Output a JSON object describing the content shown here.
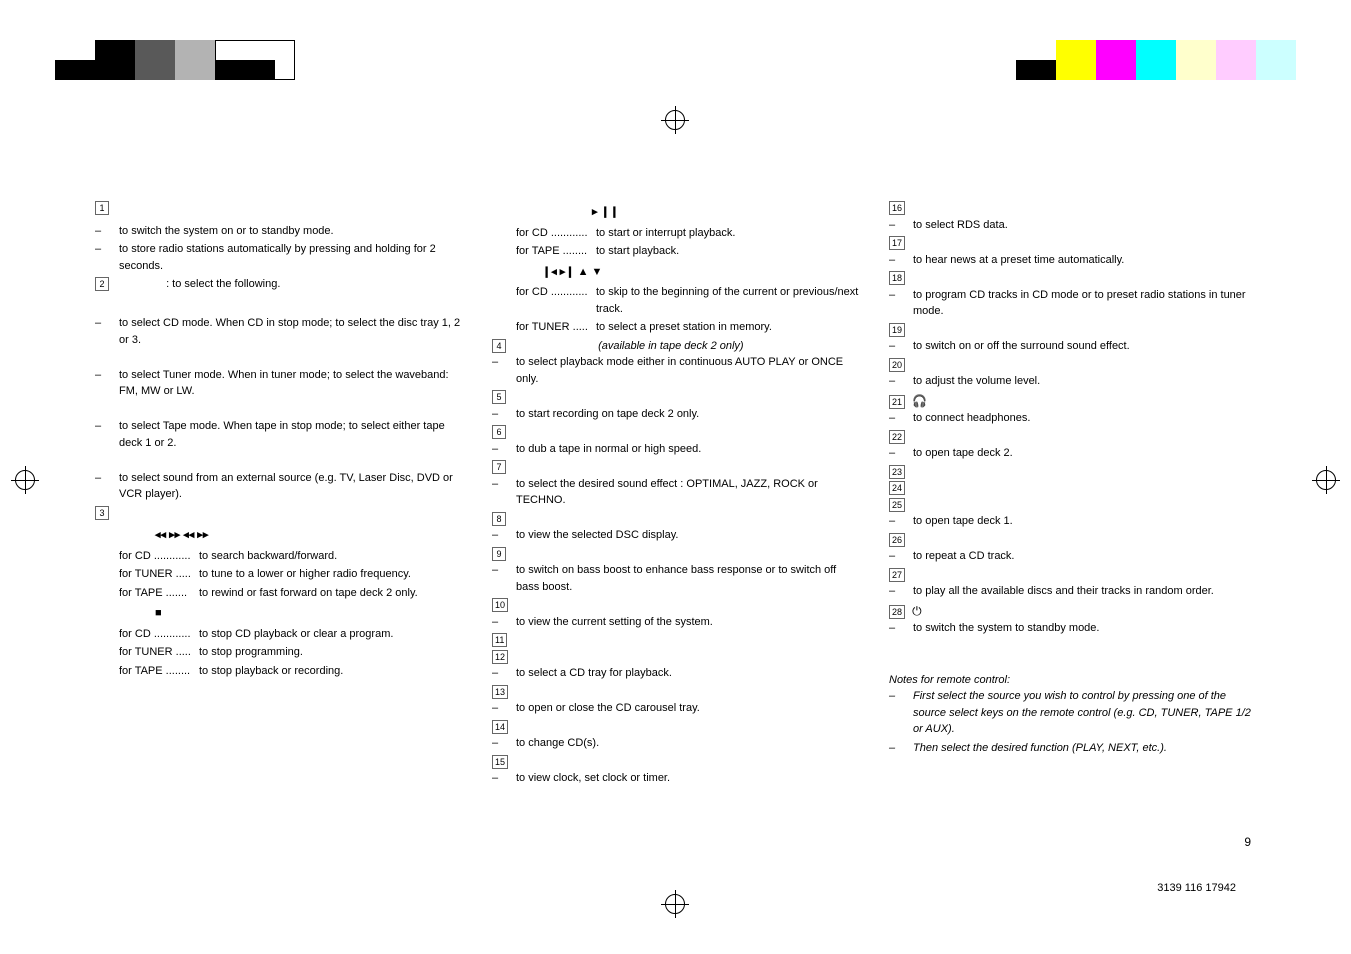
{
  "col1": {
    "n1_items": [
      "to switch the system on or to standby mode.",
      "to store radio stations automatically by pressing and holding for 2 seconds."
    ],
    "n2_intro": ": to select the following.",
    "n2_items": [
      "to select CD mode. When CD in stop mode; to select the disc tray 1, 2 or 3.",
      "to select Tuner mode. When in tuner mode; to select the waveband: FM, MW or LW.",
      "to select Tape mode. When tape in stop mode; to select either tape deck 1 or 2.",
      "to select sound from an external source (e.g. TV, Laser Disc, DVD or VCR player)."
    ],
    "n3_symbols": "◂◂ ▸▸          ◂◂ ▸▸",
    "n3_cd": "to search backward/forward.",
    "n3_tuner": "to tune to a lower or higher radio frequency.",
    "n3_tape": "to rewind or fast forward on tape deck 2 only.",
    "n3_stop": "■",
    "n3_cd_stop": "to stop CD playback or clear a program.",
    "n3_tuner_stop": "to stop programming.",
    "n3_tape_stop": "to stop playback or recording.",
    "labels": {
      "for_cd": "for CD ............",
      "for_tuner": "for TUNER .....",
      "for_tape": " for TAPE .......",
      "for_tape2": "for TAPE ........"
    }
  },
  "col2": {
    "sym_play": "▸ ❙❙",
    "cd_play": "to start or interrupt playback.",
    "tape_play": "to start playback.",
    "sym_skip": "❙◂          ▸❙          ▲ ▼",
    "cd_skip": "to skip to the beginning of the current or previous/next track.",
    "tuner_skip": "to select a preset station in memory.",
    "n4_note": "(available in tape deck 2 only)",
    "n4_item": "to select playback mode either in continuous AUTO PLAY or ONCE only.",
    "n5": "to start recording on tape deck 2 only.",
    "n6": "to dub a tape in normal or high speed.",
    "n7": "to select the desired sound effect : OPTIMAL, JAZZ, ROCK or TECHNO.",
    "n8": "to view the selected DSC display.",
    "n9": "to switch on bass boost to enhance bass response or to switch off bass boost.",
    "n10": "to view the current setting of the system.",
    "n12": "to select a CD tray for playback.",
    "n13": "to open or close the CD carousel tray.",
    "n14": "to change CD(s).",
    "n15": "to view clock, set clock or timer.",
    "labels": {
      "for_cd": "for CD ............",
      "for_tuner": "for TUNER .....",
      "for_tape": "for TAPE ........"
    }
  },
  "col3": {
    "n16": "to select RDS data.",
    "n17": "to hear news at a preset time automatically.",
    "n18": "to program CD tracks in CD mode or to preset radio stations in tuner mode.",
    "n19": "to switch on or off the surround sound effect.",
    "n20": "to adjust the volume level.",
    "n21_sym": "🎧",
    "n21": "to connect headphones.",
    "n22": "to open tape deck 2.",
    "n25": "to open tape deck 1.",
    "n26": "to repeat a CD track.",
    "n27": "to play all the available discs and their tracks in random order.",
    "n28_sym": "⏻",
    "n28": "to switch the system to standby mode.",
    "notes_title": "Notes for remote control:",
    "note1": "First select the source you wish to control by pressing one of the source select keys on the remote control (e.g.  CD, TUNER, TAPE 1/2 or AUX).",
    "note2": "Then select the desired function (PLAY, NEXT, etc.)."
  },
  "page_num": "9",
  "doc_id": "3139 116 17942"
}
